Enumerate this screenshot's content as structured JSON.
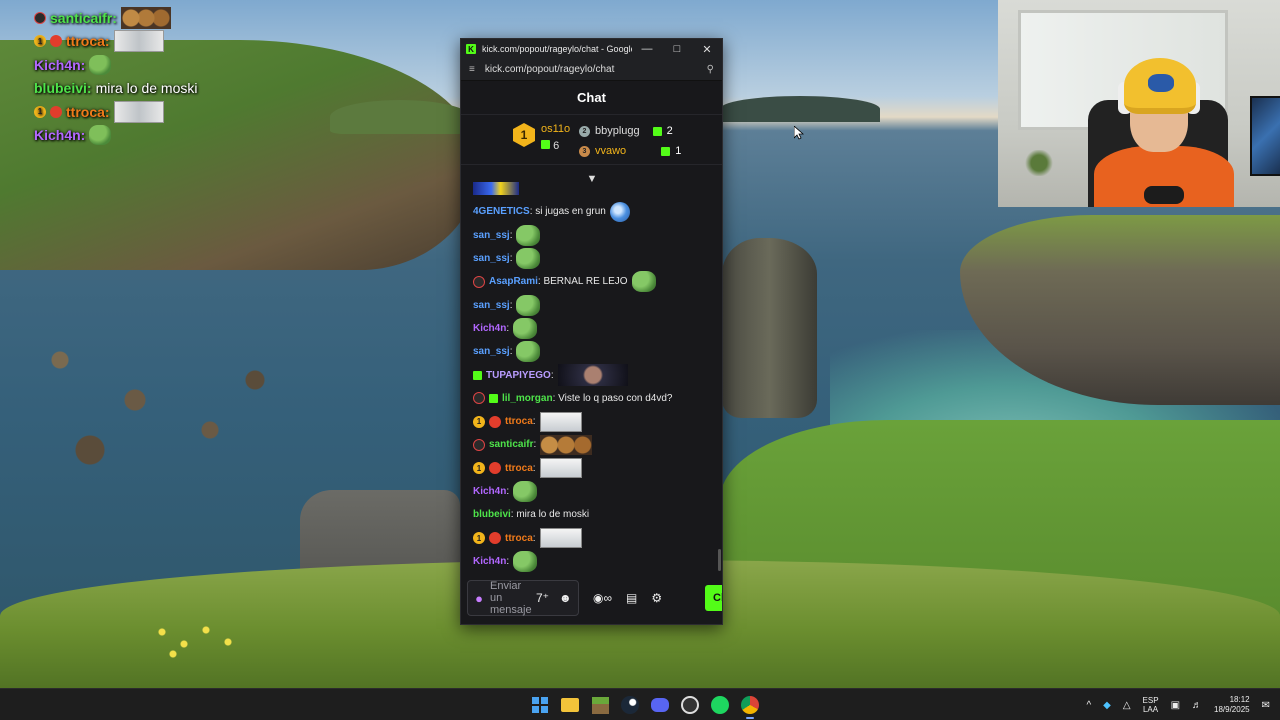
{
  "overlay_chat": [
    {
      "user": "santicaifr:",
      "color": "#4ee44a",
      "badges": [
        "dark"
      ],
      "message": "",
      "emote": "faces"
    },
    {
      "user": "ttroca:",
      "color": "#f07a1a",
      "badges": [
        "gold",
        "red"
      ],
      "message": "",
      "emote": "wide"
    },
    {
      "user": "Kich4n:",
      "color": "#b267ff",
      "badges": [],
      "message": "",
      "emote": "pepe"
    },
    {
      "user": "blubeivi:",
      "color": "#4ee44a",
      "badges": [],
      "message": "mira lo de moski",
      "emote": ""
    },
    {
      "user": "ttroca:",
      "color": "#f07a1a",
      "badges": [
        "gold",
        "red"
      ],
      "message": "",
      "emote": "wide"
    },
    {
      "user": "Kich4n:",
      "color": "#b267ff",
      "badges": [],
      "message": "",
      "emote": "pepe"
    }
  ],
  "popup": {
    "window_title": "kick.com/popout/rageylo/chat - Google C...",
    "url": "kick.com/popout/rageylo/chat",
    "header": "Chat",
    "leaderboard": {
      "first": {
        "rank": "1",
        "name": "os11o",
        "count": "6"
      },
      "second": {
        "rank": "2",
        "name": "bbyplugg",
        "count": "2"
      },
      "third": {
        "rank": "3",
        "name": "vvawo",
        "count": "1"
      }
    },
    "messages": [
      {
        "user": "",
        "color": "#5aa0ff",
        "badges": [],
        "text": "",
        "emote": "banner"
      },
      {
        "user": "4GENETICS",
        "color": "#5aa0ff",
        "badges": [],
        "text": ": si jugas en grun",
        "emote": "globe"
      },
      {
        "user": "san_ssj",
        "color": "#5aa0ff",
        "badges": [],
        "text": ":",
        "emote": "pepe"
      },
      {
        "user": "san_ssj",
        "color": "#5aa0ff",
        "badges": [],
        "text": ":",
        "emote": "pepe"
      },
      {
        "user": "AsapRami",
        "color": "#5aa0ff",
        "badges": [
          "dark"
        ],
        "text": ": BERNAL RE LEJO",
        "emote": "pepe"
      },
      {
        "user": "san_ssj",
        "color": "#5aa0ff",
        "badges": [],
        "text": ":",
        "emote": "pepe"
      },
      {
        "user": "Kich4n",
        "color": "#b267ff",
        "badges": [],
        "text": ":",
        "emote": "pepe"
      },
      {
        "user": "san_ssj",
        "color": "#5aa0ff",
        "badges": [],
        "text": ":",
        "emote": "pepe"
      },
      {
        "user": "TUPAPIYEGO",
        "color": "#b99cff",
        "badges": [
          "gift"
        ],
        "text": ":",
        "emote": "dark"
      },
      {
        "user": "lil_morgan",
        "color": "#4ee44a",
        "badges": [
          "dark",
          "gift"
        ],
        "text": ": Viste lo q paso con d4vd?",
        "emote": ""
      },
      {
        "user": "ttroca",
        "color": "#f07a1a",
        "badges": [
          "gold",
          "red"
        ],
        "text": ":",
        "emote": "wide"
      },
      {
        "user": "santicaifr",
        "color": "#4ee44a",
        "badges": [
          "dark"
        ],
        "text": ":",
        "emote": "faces"
      },
      {
        "user": "ttroca",
        "color": "#f07a1a",
        "badges": [
          "gold",
          "red"
        ],
        "text": ":",
        "emote": "wide"
      },
      {
        "user": "Kich4n",
        "color": "#b267ff",
        "badges": [],
        "text": ":",
        "emote": "pepe"
      },
      {
        "user": "blubeivi",
        "color": "#4ee44a",
        "badges": [],
        "text": ": mira lo de moski",
        "emote": ""
      },
      {
        "user": "ttroca",
        "color": "#f07a1a",
        "badges": [
          "gold",
          "red"
        ],
        "text": ":",
        "emote": "wide"
      },
      {
        "user": "Kich4n",
        "color": "#b267ff",
        "badges": [],
        "text": ":",
        "emote": "pepe"
      }
    ],
    "composer": {
      "placeholder": "Enviar un mensaje",
      "send_label": "Ch"
    }
  },
  "taskbar": {
    "apps": [
      "windows-start",
      "file-explorer",
      "minecraft",
      "steam",
      "discord",
      "obs-studio",
      "spotify",
      "chrome"
    ],
    "tray_lang_top": "ESP",
    "tray_lang_bottom": "LAA",
    "time": "18:12",
    "date": "18/9/2025"
  },
  "colors": {
    "kick_green": "#53fc18",
    "chat_bg": "#18181b",
    "taskbar_bg": "#1e1e1e"
  }
}
